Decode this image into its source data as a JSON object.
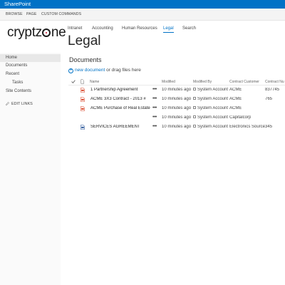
{
  "suitebar": {
    "brand": "SharePoint"
  },
  "ribbon": {
    "tabs": [
      "BROWSE",
      "PAGE",
      "CUSTOM COMMANDS"
    ]
  },
  "logo": {
    "text_left": "cryptz",
    "text_right": "ne"
  },
  "topnav": [
    "Intranet",
    "Accounting",
    "Human Resources",
    "Legal",
    "Search"
  ],
  "page": {
    "title": "Legal"
  },
  "leftnav": {
    "items": [
      "Home",
      "Documents",
      "Recent",
      "Tasks",
      "Site Contents"
    ],
    "edit_links": "EDIT LINKS"
  },
  "library": {
    "title": "Documents",
    "new_document": "new document",
    "drag_text": " or drag files here",
    "columns": [
      "Name",
      "Modified",
      "Modified By",
      "Contract Customer",
      "Contract Nu"
    ],
    "rows": [
      {
        "name": "1 Partnership Agreement",
        "modified": "10 minutes ago",
        "modified_by": "System Account",
        "customer": "ACME",
        "number": "837745",
        "icon": "pdf-icon",
        "icon_color": "#d9472b"
      },
      {
        "name": "ACME 3X3 Contract - 2013 #",
        "modified": "10 minutes ago",
        "modified_by": "System Account",
        "customer": "ACME",
        "number": "765",
        "icon": "pdf-icon",
        "icon_color": "#d9472b"
      },
      {
        "name": "ACME Purchase of Real Estate",
        "modified": "10 minutes ago",
        "modified_by": "System Account",
        "customer": "ACME",
        "number": "",
        "icon": "pdf-icon",
        "icon_color": "#d9472b"
      },
      {
        "name": "",
        "modified": "10 minutes ago",
        "modified_by": "System Account",
        "customer": "Capitalcorp",
        "number": "",
        "icon": "",
        "icon_color": ""
      },
      {
        "name": "SERVICES AGREEMENT",
        "modified": "10 minutes ago",
        "modified_by": "System Account",
        "customer": "Electronics Source",
        "number": "345",
        "icon": "word-icon",
        "icon_color": "#2b579a"
      }
    ]
  },
  "colors": {
    "accent": "#0072c6",
    "brand_red": "#c8102e"
  }
}
